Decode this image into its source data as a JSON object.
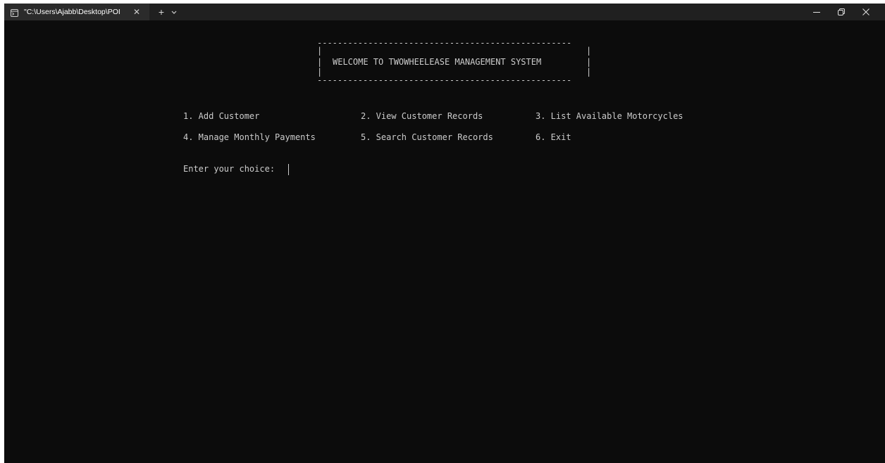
{
  "tab": {
    "title": "\"C:\\Users\\Ajabb\\Desktop\\POI",
    "close_glyph": "✕",
    "icon": "terminal-icon"
  },
  "tabbar": {
    "new_tab_glyph": "+",
    "dropdown_icon": "chevron-down-icon"
  },
  "window_controls": {
    "minimize_icon": "minimize-icon",
    "maximize_icon": "restore-icon",
    "close_icon": "close-icon"
  },
  "terminal": {
    "banner": {
      "border_top": "--------------------------------------------------",
      "border_bottom": "--------------------------------------------------",
      "pipe": "|",
      "title": "WELCOME TO TWOWHEELEASE MANAGEMENT SYSTEM"
    },
    "menu": [
      "1. Add Customer",
      "2. View Customer Records",
      "3. List Available Motorcycles",
      "4. Manage Monthly Payments",
      "5. Search Customer Records",
      "6. Exit"
    ],
    "prompt": "Enter your choice: "
  },
  "colors": {
    "terminal_bg": "#0c0c0c",
    "terminal_fg": "#cccccc",
    "titlebar_bg": "#202020",
    "active_tab_bg": "#2b2b2b"
  }
}
